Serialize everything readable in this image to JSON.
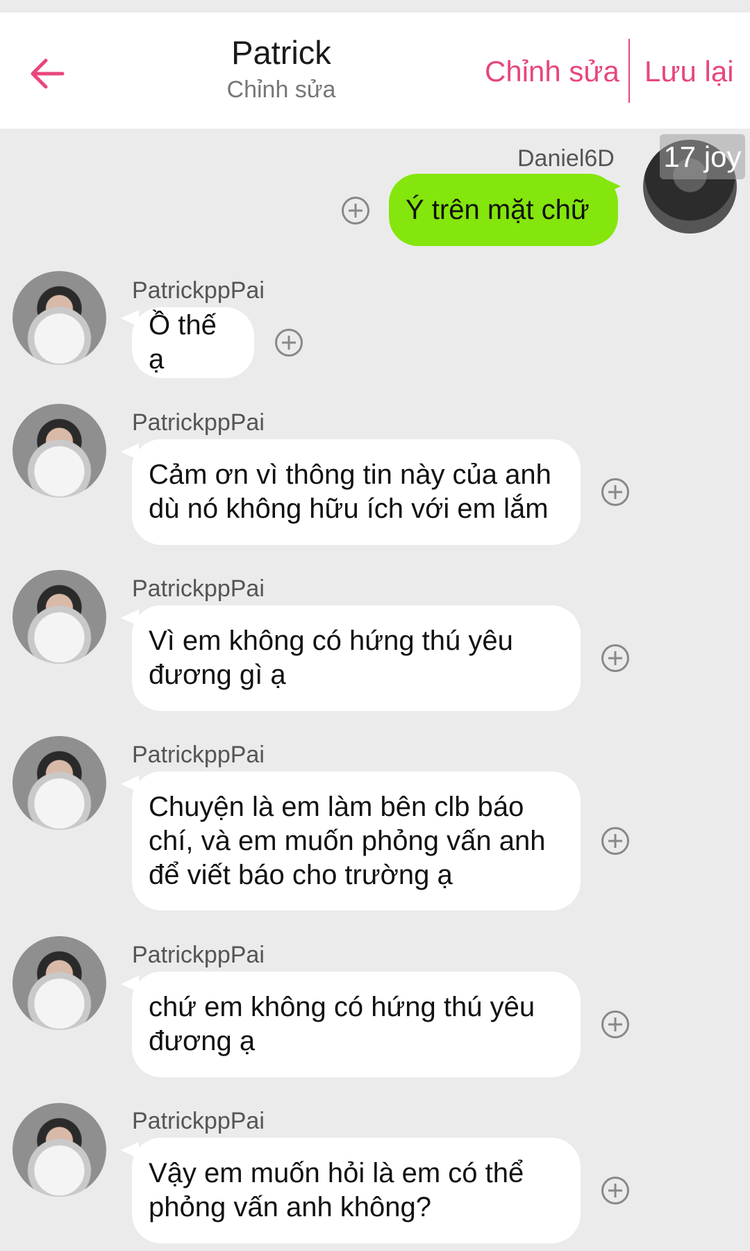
{
  "header": {
    "title": "Patrick",
    "subtitle": "Chỉnh sửa",
    "edit_label": "Chỉnh sửa",
    "save_label": "Lưu lại",
    "accent_color": "#e8467c"
  },
  "self_message": {
    "sender": "Daniel6D",
    "text": "Ý trên mặt chữ",
    "badge": "17 joy",
    "bubble_color": "#84e60c"
  },
  "messages": [
    {
      "sender": "PatrickppPai",
      "lines": [
        "Ồ thế ạ"
      ]
    },
    {
      "sender": "PatrickppPai",
      "lines": [
        "Cảm ơn vì thông tin này của anh",
        "dù nó không hữu ích với em lắm"
      ]
    },
    {
      "sender": "PatrickppPai",
      "lines": [
        "Vì em không có hứng thú yêu",
        "đương gì ạ"
      ]
    },
    {
      "sender": "PatrickppPai",
      "lines": [
        "Chuyện là em làm bên clb báo",
        "chí, và em muốn phỏng vấn anh",
        "để viết báo cho trường ạ"
      ]
    },
    {
      "sender": "PatrickppPai",
      "lines": [
        "chứ em không có hứng thú yêu",
        "đương ạ"
      ]
    },
    {
      "sender": "PatrickppPai",
      "lines": [
        "Vậy em muốn hỏi là em có thể",
        "phỏng vấn anh không?"
      ]
    }
  ],
  "icons": {
    "back": "arrow-left-icon",
    "add_reaction": "plus-circle-icon"
  }
}
